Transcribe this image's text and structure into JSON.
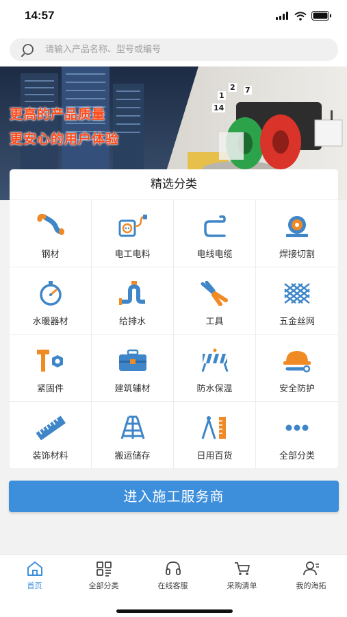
{
  "status_bar": {
    "time": "14:57"
  },
  "search": {
    "placeholder": "请输入产品名称、型号或编号"
  },
  "banner": {
    "line1": "更高的产品质量",
    "line2": "更安心的用户体验",
    "room_numbers": [
      "1",
      "2",
      "7",
      "14"
    ]
  },
  "categories": {
    "title": "精选分类",
    "items": [
      {
        "label": "钢材",
        "icon": "steel-pipe-icon"
      },
      {
        "label": "电工电料",
        "icon": "electrical-socket-icon"
      },
      {
        "label": "电线电缆",
        "icon": "cable-icon"
      },
      {
        "label": "焊接切割",
        "icon": "welding-icon"
      },
      {
        "label": "水暖器材",
        "icon": "pressure-gauge-icon"
      },
      {
        "label": "给排水",
        "icon": "water-pipe-icon"
      },
      {
        "label": "工具",
        "icon": "pliers-icon"
      },
      {
        "label": "五金丝网",
        "icon": "wire-mesh-icon"
      },
      {
        "label": "紧固件",
        "icon": "bolt-nut-icon"
      },
      {
        "label": "建筑辅材",
        "icon": "toolbox-icon"
      },
      {
        "label": "防水保温",
        "icon": "barrier-icon"
      },
      {
        "label": "安全防护",
        "icon": "safety-helmet-icon"
      },
      {
        "label": "装饰材料",
        "icon": "ruler-icon"
      },
      {
        "label": "搬运储存",
        "icon": "ladder-icon"
      },
      {
        "label": "日用百货",
        "icon": "compass-ruler-icon"
      },
      {
        "label": "全部分类",
        "icon": "more-dots-icon"
      }
    ]
  },
  "cta": {
    "label": "进入施工服务商"
  },
  "tabbar": {
    "items": [
      {
        "label": "首页",
        "icon": "home-icon",
        "active": true
      },
      {
        "label": "全部分类",
        "icon": "category-grid-icon",
        "active": false
      },
      {
        "label": "在线客服",
        "icon": "headset-icon",
        "active": false
      },
      {
        "label": "采购清单",
        "icon": "cart-icon",
        "active": false
      },
      {
        "label": "我的海拓",
        "icon": "user-icon",
        "active": false
      }
    ]
  },
  "colors": {
    "accent": "#3d8fdc",
    "icon_blue": "#3f86c8",
    "icon_orange": "#f08a24",
    "banner_text": "#ff4a1a"
  }
}
